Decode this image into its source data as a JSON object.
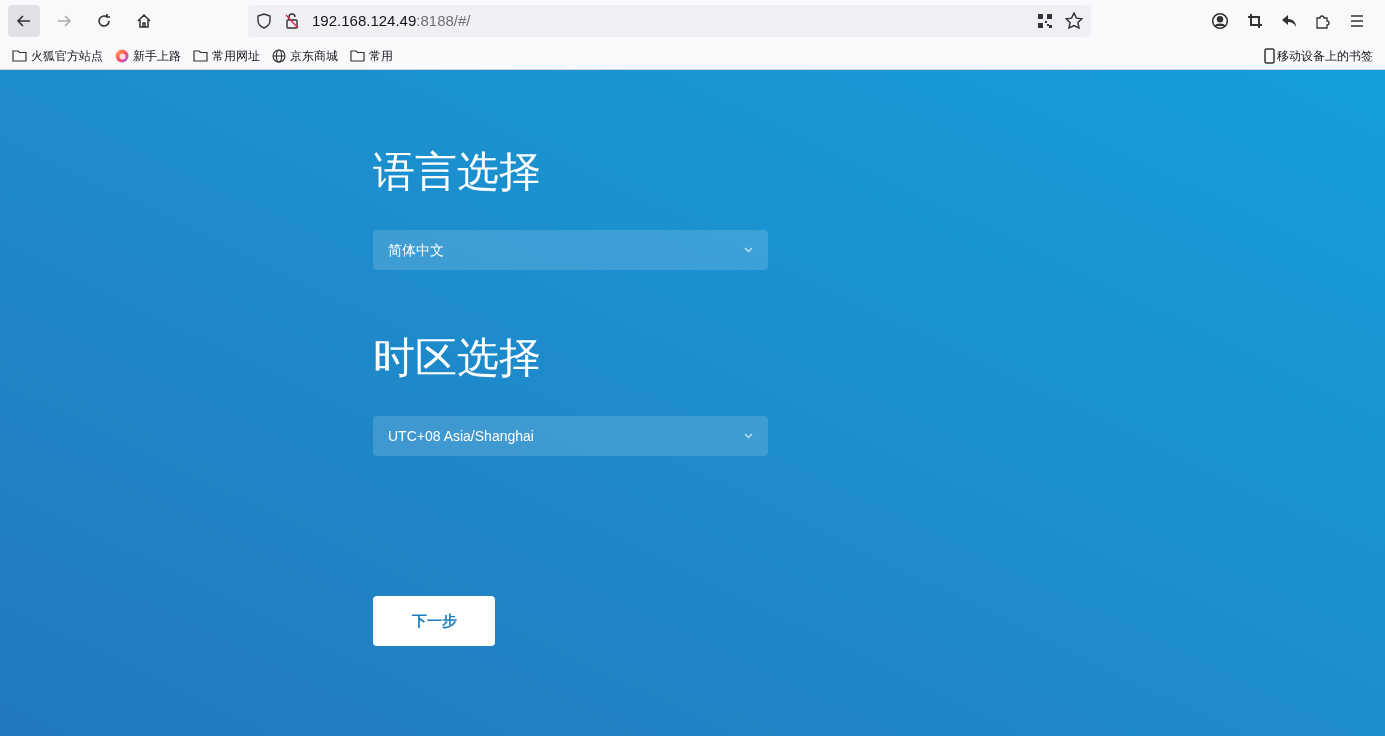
{
  "browser": {
    "url_host": "192.168.124.49",
    "url_rest": ":8188/#/",
    "bookmarks": [
      {
        "kind": "folder",
        "label": "火狐官方站点"
      },
      {
        "kind": "firefox",
        "label": "新手上路"
      },
      {
        "kind": "folder",
        "label": "常用网址"
      },
      {
        "kind": "globe",
        "label": "京东商城"
      },
      {
        "kind": "folder",
        "label": "常用"
      }
    ],
    "mobile_bookmarks": "移动设备上的书签"
  },
  "sections": [
    {
      "title": "语言选择",
      "value": "简体中文"
    },
    {
      "title": "时区选择",
      "value": "UTC+08 Asia/Shanghai"
    }
  ],
  "next_button": "下一步"
}
